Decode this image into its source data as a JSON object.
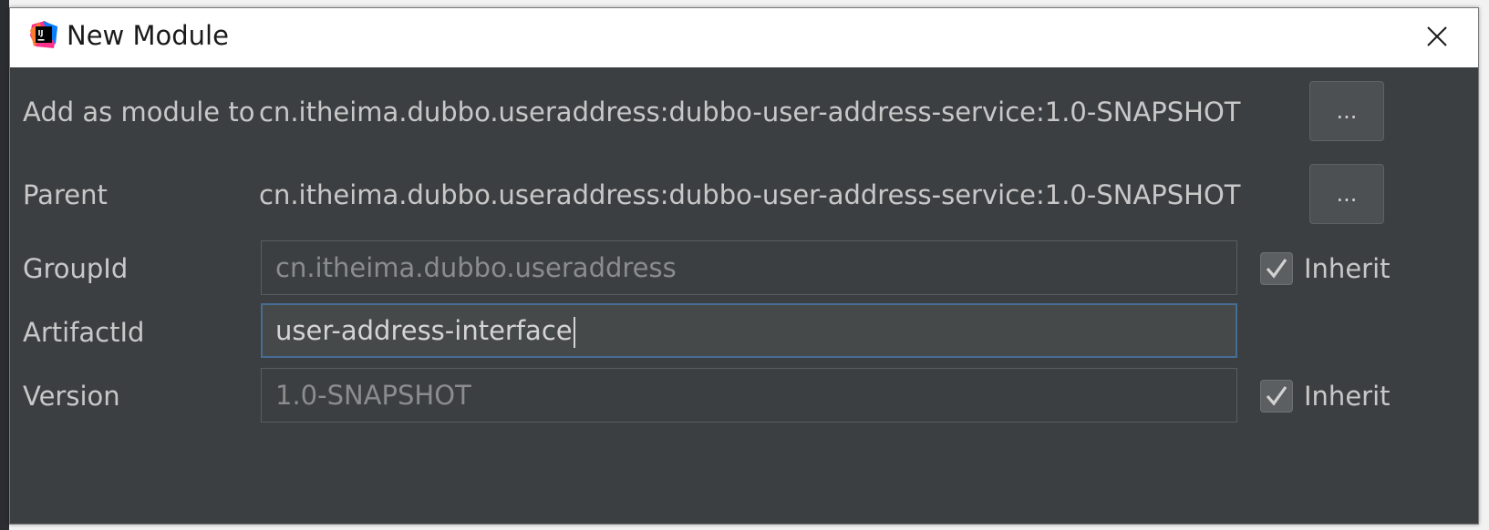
{
  "window": {
    "title": "New Module",
    "icon": "intellij-idea-icon",
    "close_icon": "close-icon"
  },
  "form": {
    "add_as_module": {
      "label": "Add as module to",
      "value": "cn.itheima.dubbo.useraddress:dubbo-user-address-service:1.0-SNAPSHOT",
      "button_label": "..."
    },
    "parent": {
      "label": "Parent",
      "value": "cn.itheima.dubbo.useraddress:dubbo-user-address-service:1.0-SNAPSHOT",
      "button_label": "..."
    },
    "group_id": {
      "label": "GroupId",
      "value": "cn.itheima.dubbo.useraddress",
      "inherit_label": "Inherit",
      "inherit_checked": true
    },
    "artifact_id": {
      "label": "ArtifactId",
      "value": "user-address-interface"
    },
    "version": {
      "label": "Version",
      "value": "1.0-SNAPSHOT",
      "inherit_label": "Inherit",
      "inherit_checked": true
    }
  },
  "colors": {
    "dialog_background": "#3c3f41",
    "titlebar_background": "#ffffff",
    "focus_border": "#466d94",
    "text": "#c8c8c8"
  }
}
